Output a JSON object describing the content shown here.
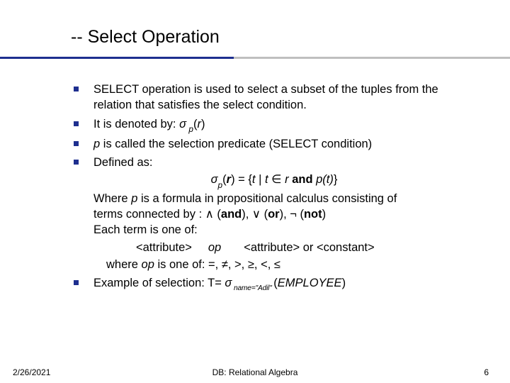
{
  "title": "-- Select Operation",
  "bullets": {
    "b1": "SELECT operation is used to select a subset of the tuples from the relation that satisfies the select condition.",
    "b2_pre": "It is denoted by:  ",
    "b2_sigma": "σ",
    "b2_sub": " p",
    "b2_post_open": "(",
    "b2_r": "r",
    "b2_post_close": ")",
    "b3_p": "p",
    "b3_rest": " is called the selection predicate (SELECT condition)",
    "b4": "Defined as:",
    "def_sigma": "σ",
    "def_sub": "p",
    "def_open": "(",
    "def_r": "r",
    "def_mid1": ") = {",
    "def_t1": "t",
    "def_bar": " | ",
    "def_t2": "t",
    "def_in": " ∈ ",
    "def_r2": "r ",
    "def_and": "and",
    "def_space": " ",
    "def_pt": "p(t)",
    "def_close": "}",
    "where1a": "Where ",
    "where1_p": "p",
    "where1b": " is a formula in propositional calculus consisting of",
    "where2a": "terms connected by : ∧ (",
    "where2_and": "and",
    "where2b": "), ∨ (",
    "where2_or": "or",
    "where2c": "), ¬ (",
    "where2_not": "not",
    "where2d": ")",
    "each": "Each term is one of:",
    "term_a1": "<attribute>",
    "term_op": "op",
    "term_a2": "<attribute> or <constant>",
    "opwhere_a": " where ",
    "opwhere_op": "op",
    "opwhere_b": " is one of:  =, ≠, >, ≥, <, ≤",
    "ex_a": "Example of selection:  T= ",
    "ex_sigma": "σ",
    "ex_sub": " name=\"Adil\" ",
    "ex_open": "(",
    "ex_rel": "EMPLOYEE",
    "ex_close": ")"
  },
  "footer": {
    "left": "2/26/2021",
    "center": "DB: Relational Algebra",
    "right": "6"
  }
}
